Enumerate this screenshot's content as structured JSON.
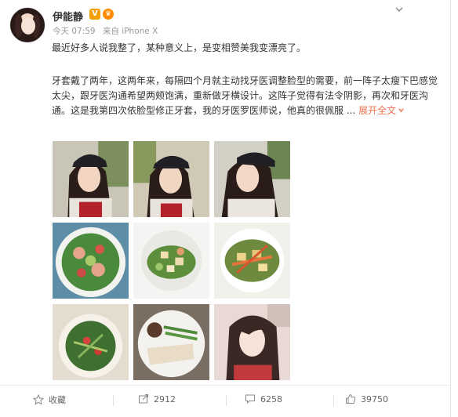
{
  "post": {
    "author": "伊能静",
    "verified_badge": "V",
    "member_badge": "♛",
    "time": "今天 07:59",
    "source": "来自 iPhone X",
    "line1": "最近好多人说我整了，某种意义上，是变相赞美我变漂亮了。",
    "body": "牙套戴了两年，这两年来，每隔四个月就主动找牙医调整脸型的需要，前一阵子太瘦下巴感觉太尖，跟牙医沟通希望两颊饱满，重新做牙横设计。这阵子觉得有法令阴影，再次和牙医沟通。这是我第四次依脸型修正牙套，我的牙医罗医师说，他真的很佩服 ...",
    "expand": "展开全文",
    "expand_icon": "chevron-down-icon"
  },
  "footer": {
    "favorite": "收藏",
    "repost": "2912",
    "comment": "6258",
    "like": "39750"
  },
  "colors": {
    "accent": "#eb7350",
    "verified": "#f4a000"
  }
}
